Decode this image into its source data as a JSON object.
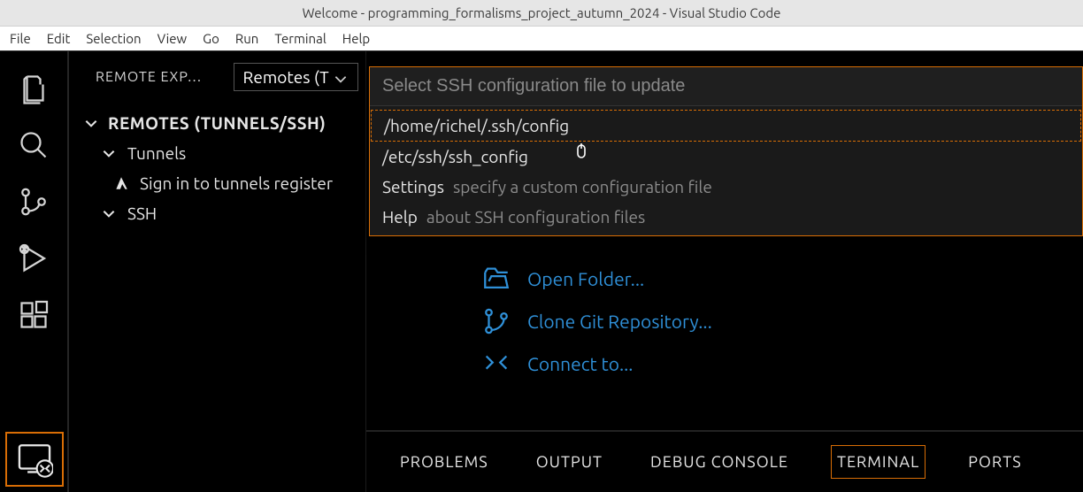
{
  "window": {
    "title": "Welcome - programming_formalisms_project_autumn_2024 - Visual Studio Code"
  },
  "menu": {
    "items": [
      "File",
      "Edit",
      "Selection",
      "View",
      "Go",
      "Run",
      "Terminal",
      "Help"
    ]
  },
  "sidebar": {
    "header": "REMOTE EXP…",
    "dropdown": "Remotes (T",
    "section": "REMOTES (TUNNELS/SSH)",
    "tunnels": "Tunnels",
    "tunnels_leaf": "Sign in to tunnels register",
    "ssh": "SSH"
  },
  "quickinput": {
    "placeholder": "Select SSH configuration file to update",
    "items": [
      {
        "label": "/home/richel/.ssh/config",
        "desc": "",
        "focused": true
      },
      {
        "label": "/etc/ssh/ssh_config",
        "desc": ""
      },
      {
        "label": "Settings",
        "desc": "specify a custom configuration file"
      },
      {
        "label": "Help",
        "desc": "about SSH configuration files"
      }
    ]
  },
  "welcome": {
    "open_folder": "Open Folder...",
    "clone_repo": "Clone Git Repository...",
    "connect": "Connect to..."
  },
  "panel": {
    "tabs": [
      "PROBLEMS",
      "OUTPUT",
      "DEBUG CONSOLE",
      "TERMINAL",
      "PORTS"
    ],
    "active": "TERMINAL"
  }
}
